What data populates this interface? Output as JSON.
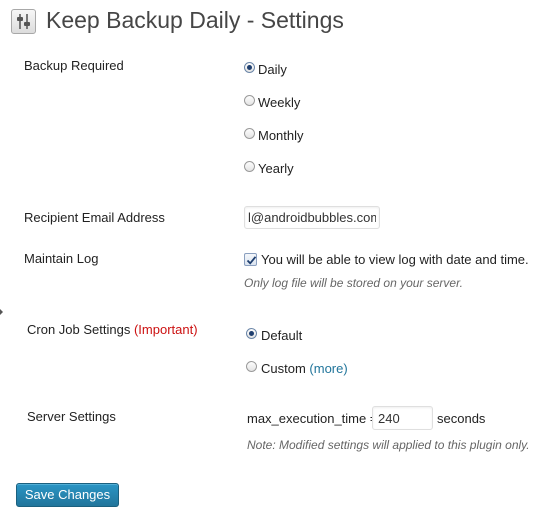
{
  "page": {
    "title": "Keep Backup Daily - Settings"
  },
  "backup": {
    "label": "Backup Required",
    "options": [
      "Daily",
      "Weekly",
      "Monthly",
      "Yearly"
    ],
    "selected": "Daily"
  },
  "email": {
    "label": "Recipient Email Address",
    "value": "l@androidbubbles.com"
  },
  "log": {
    "label": "Maintain Log",
    "checkbox_text": "You will be able to view log with date and time.",
    "checked": true,
    "note": "Only log file will be stored on your server."
  },
  "cron": {
    "label": "Cron Job Settings",
    "important": "(Important)",
    "options": [
      "Default",
      "Custom"
    ],
    "more_link": "(more)",
    "selected": "Default"
  },
  "server": {
    "label": "Server Settings",
    "field_label": "max_execution_time =",
    "value": "240",
    "unit": "seconds",
    "note": "Note: Modified settings will applied to this plugin only."
  },
  "actions": {
    "save_label": "Save Changes"
  },
  "colors": {
    "accent": "#21759b",
    "important": "#cc1111",
    "note": "#666666"
  },
  "icons": {
    "title": "settings-sliders-icon"
  }
}
